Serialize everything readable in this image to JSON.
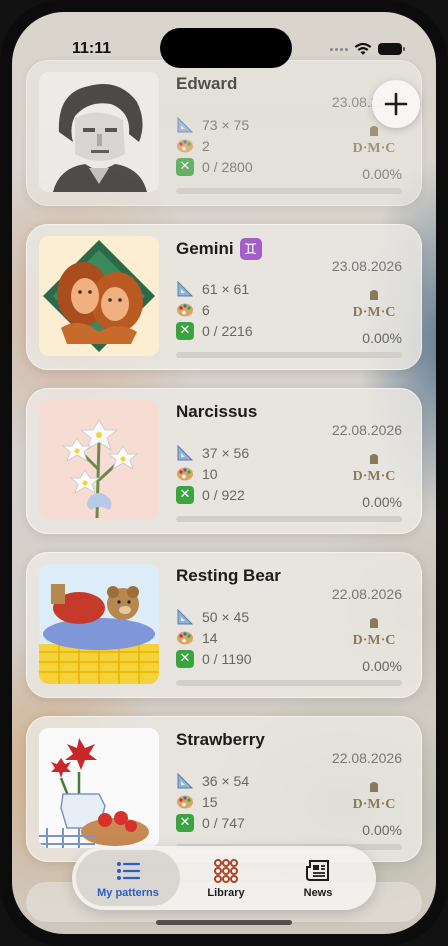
{
  "status_bar": {
    "time": "11:11"
  },
  "patterns": [
    {
      "name": "Edward",
      "size": "73 × 75",
      "colors": "2",
      "progress": "0 / 2800",
      "date": "23.08.2026",
      "percent": "0.00%",
      "progress_fraction": 0,
      "brand": "D·M·C"
    },
    {
      "name": "Gemini",
      "zodiac": "♊",
      "size": "61 × 61",
      "colors": "6",
      "progress": "0 / 2216",
      "date": "23.08.2026",
      "percent": "0.00%",
      "progress_fraction": 0,
      "brand": "D·M·C"
    },
    {
      "name": "Narcissus",
      "size": "37 × 56",
      "colors": "10",
      "progress": "0 / 922",
      "date": "22.08.2026",
      "percent": "0.00%",
      "progress_fraction": 0,
      "brand": "D·M·C"
    },
    {
      "name": "Resting Bear",
      "size": "50 × 45",
      "colors": "14",
      "progress": "0 / 1190",
      "date": "22.08.2026",
      "percent": "0.00%",
      "progress_fraction": 0,
      "brand": "D·M·C"
    },
    {
      "name": "Strawberry",
      "size": "36 × 54",
      "colors": "15",
      "progress": "0 / 747",
      "date": "22.08.2026",
      "percent": "0.00%",
      "progress_fraction": 0,
      "brand": "D·M·C"
    }
  ],
  "tabbar": {
    "tabs": [
      {
        "label": "My patterns",
        "icon": "list-icon",
        "selected": true
      },
      {
        "label": "Library",
        "icon": "grid-dots-icon",
        "selected": false
      },
      {
        "label": "News",
        "icon": "newspaper-icon",
        "selected": false
      }
    ]
  },
  "colors": {
    "selected_tab": "#2a5fc7",
    "progress_icon": "#3ba340",
    "zodiac_badge": "#a45ec8",
    "library_icon": "#a7452a"
  }
}
